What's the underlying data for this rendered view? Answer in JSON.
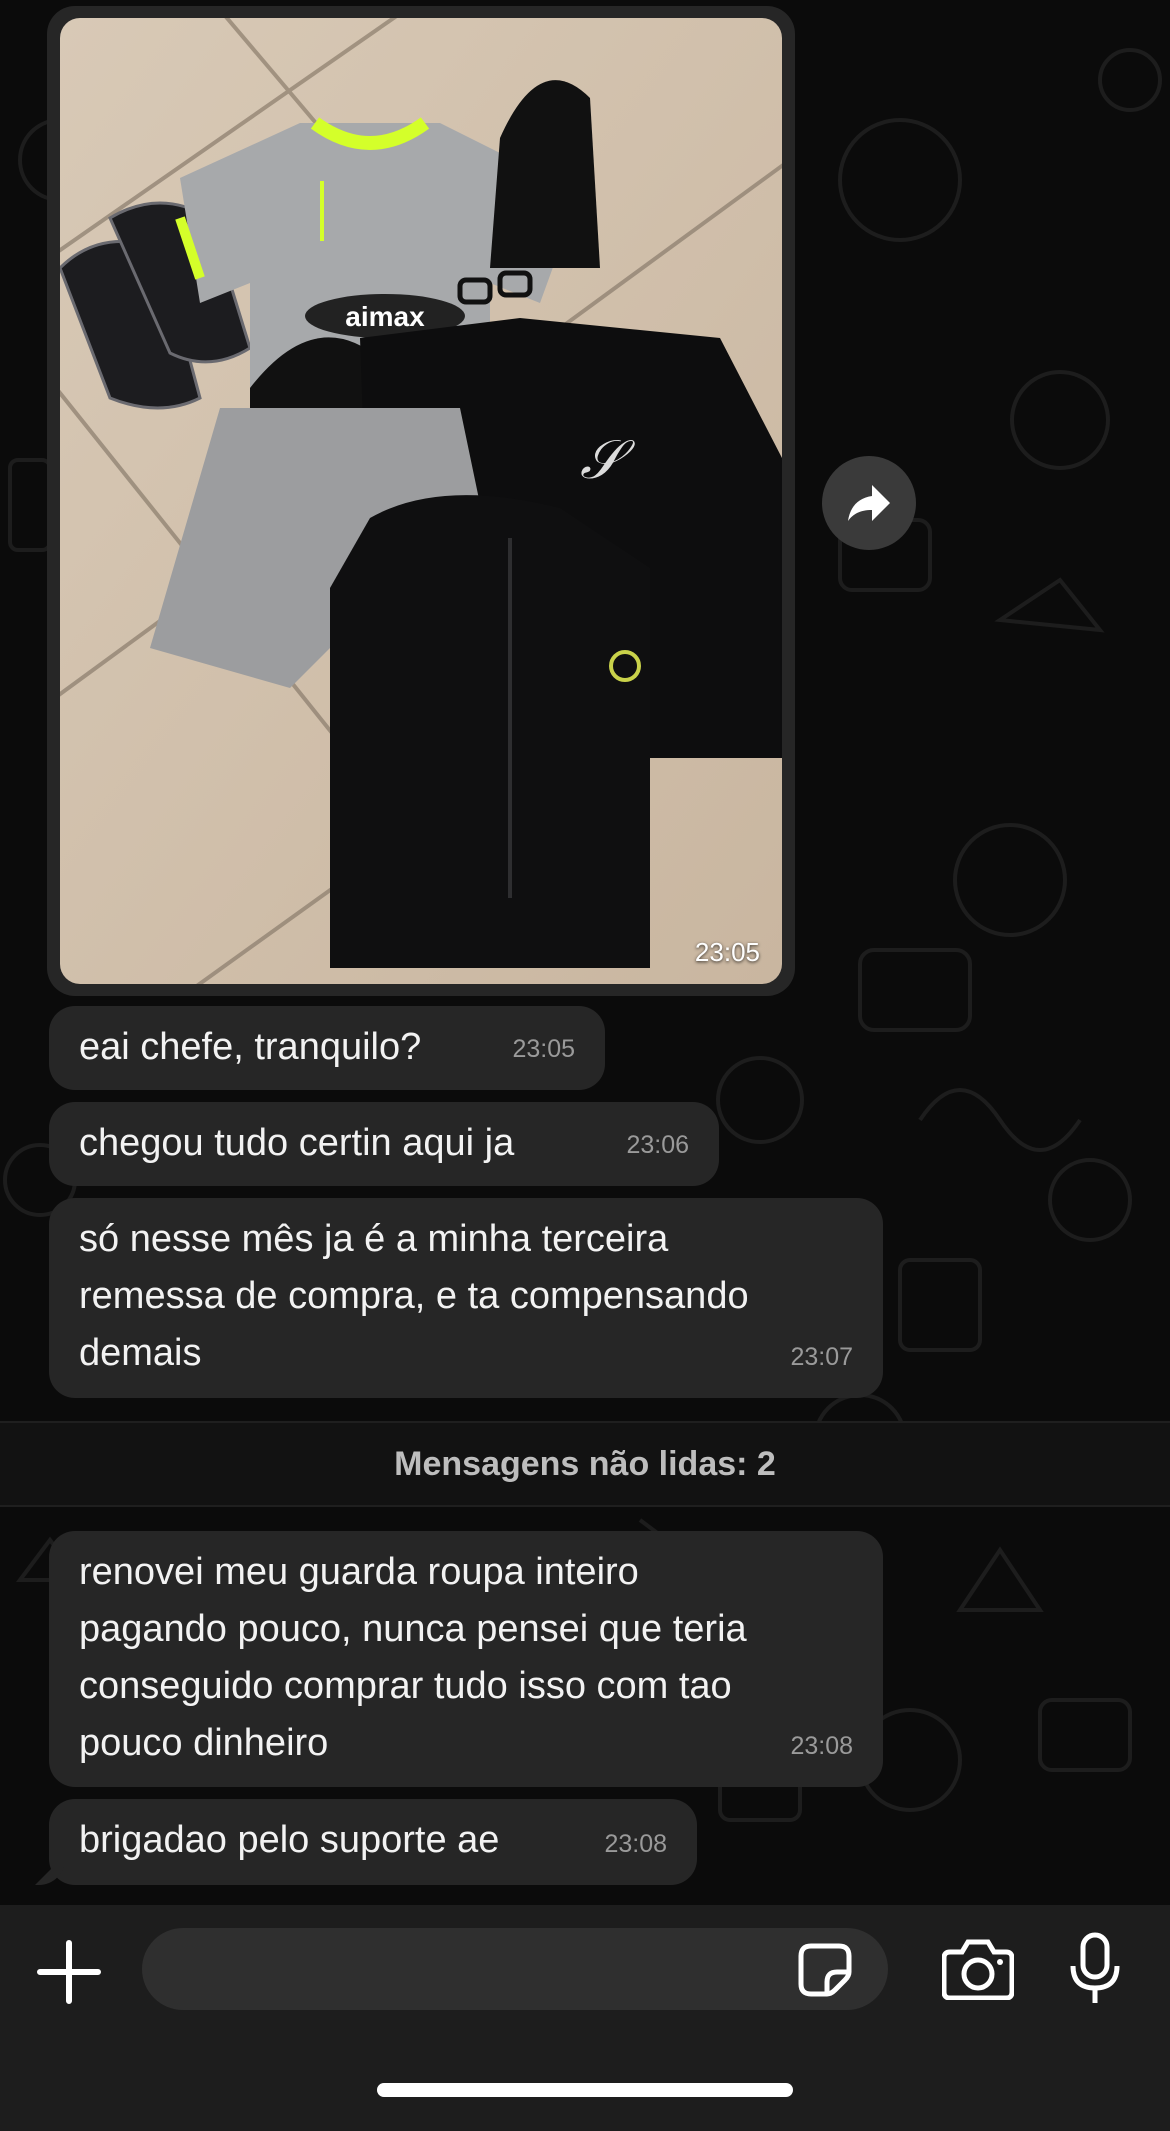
{
  "chat": {
    "image_message": {
      "time": "23:05",
      "photo_brand_text": "aimax"
    },
    "messages": [
      {
        "text": "eai chefe, tranquilo?",
        "time": "23:05"
      },
      {
        "text": "chegou tudo certin aqui ja",
        "time": "23:06"
      },
      {
        "text": "só nesse mês ja é a minha terceira\nremessa de compra, e ta compensando\ndemais",
        "time": "23:07"
      },
      {
        "text": "renovei meu guarda roupa inteiro\npagando pouco, nunca pensei que teria\nconseguido comprar tudo isso com tao\npouco dinheiro",
        "time": "23:08"
      },
      {
        "text": "brigadao pelo suporte ae",
        "time": "23:08"
      }
    ],
    "unread_banner": "Mensagens não lidas: 2"
  },
  "composer": {
    "input_value": "",
    "icons": [
      "plus-icon",
      "sticker-icon",
      "camera-icon",
      "microphone-icon"
    ]
  },
  "colors": {
    "background": "#0b0b0b",
    "bubble": "#262626",
    "text": "#f2f2f2",
    "timestamp": "#9a9a9a",
    "composer": "#1d1d1d"
  }
}
